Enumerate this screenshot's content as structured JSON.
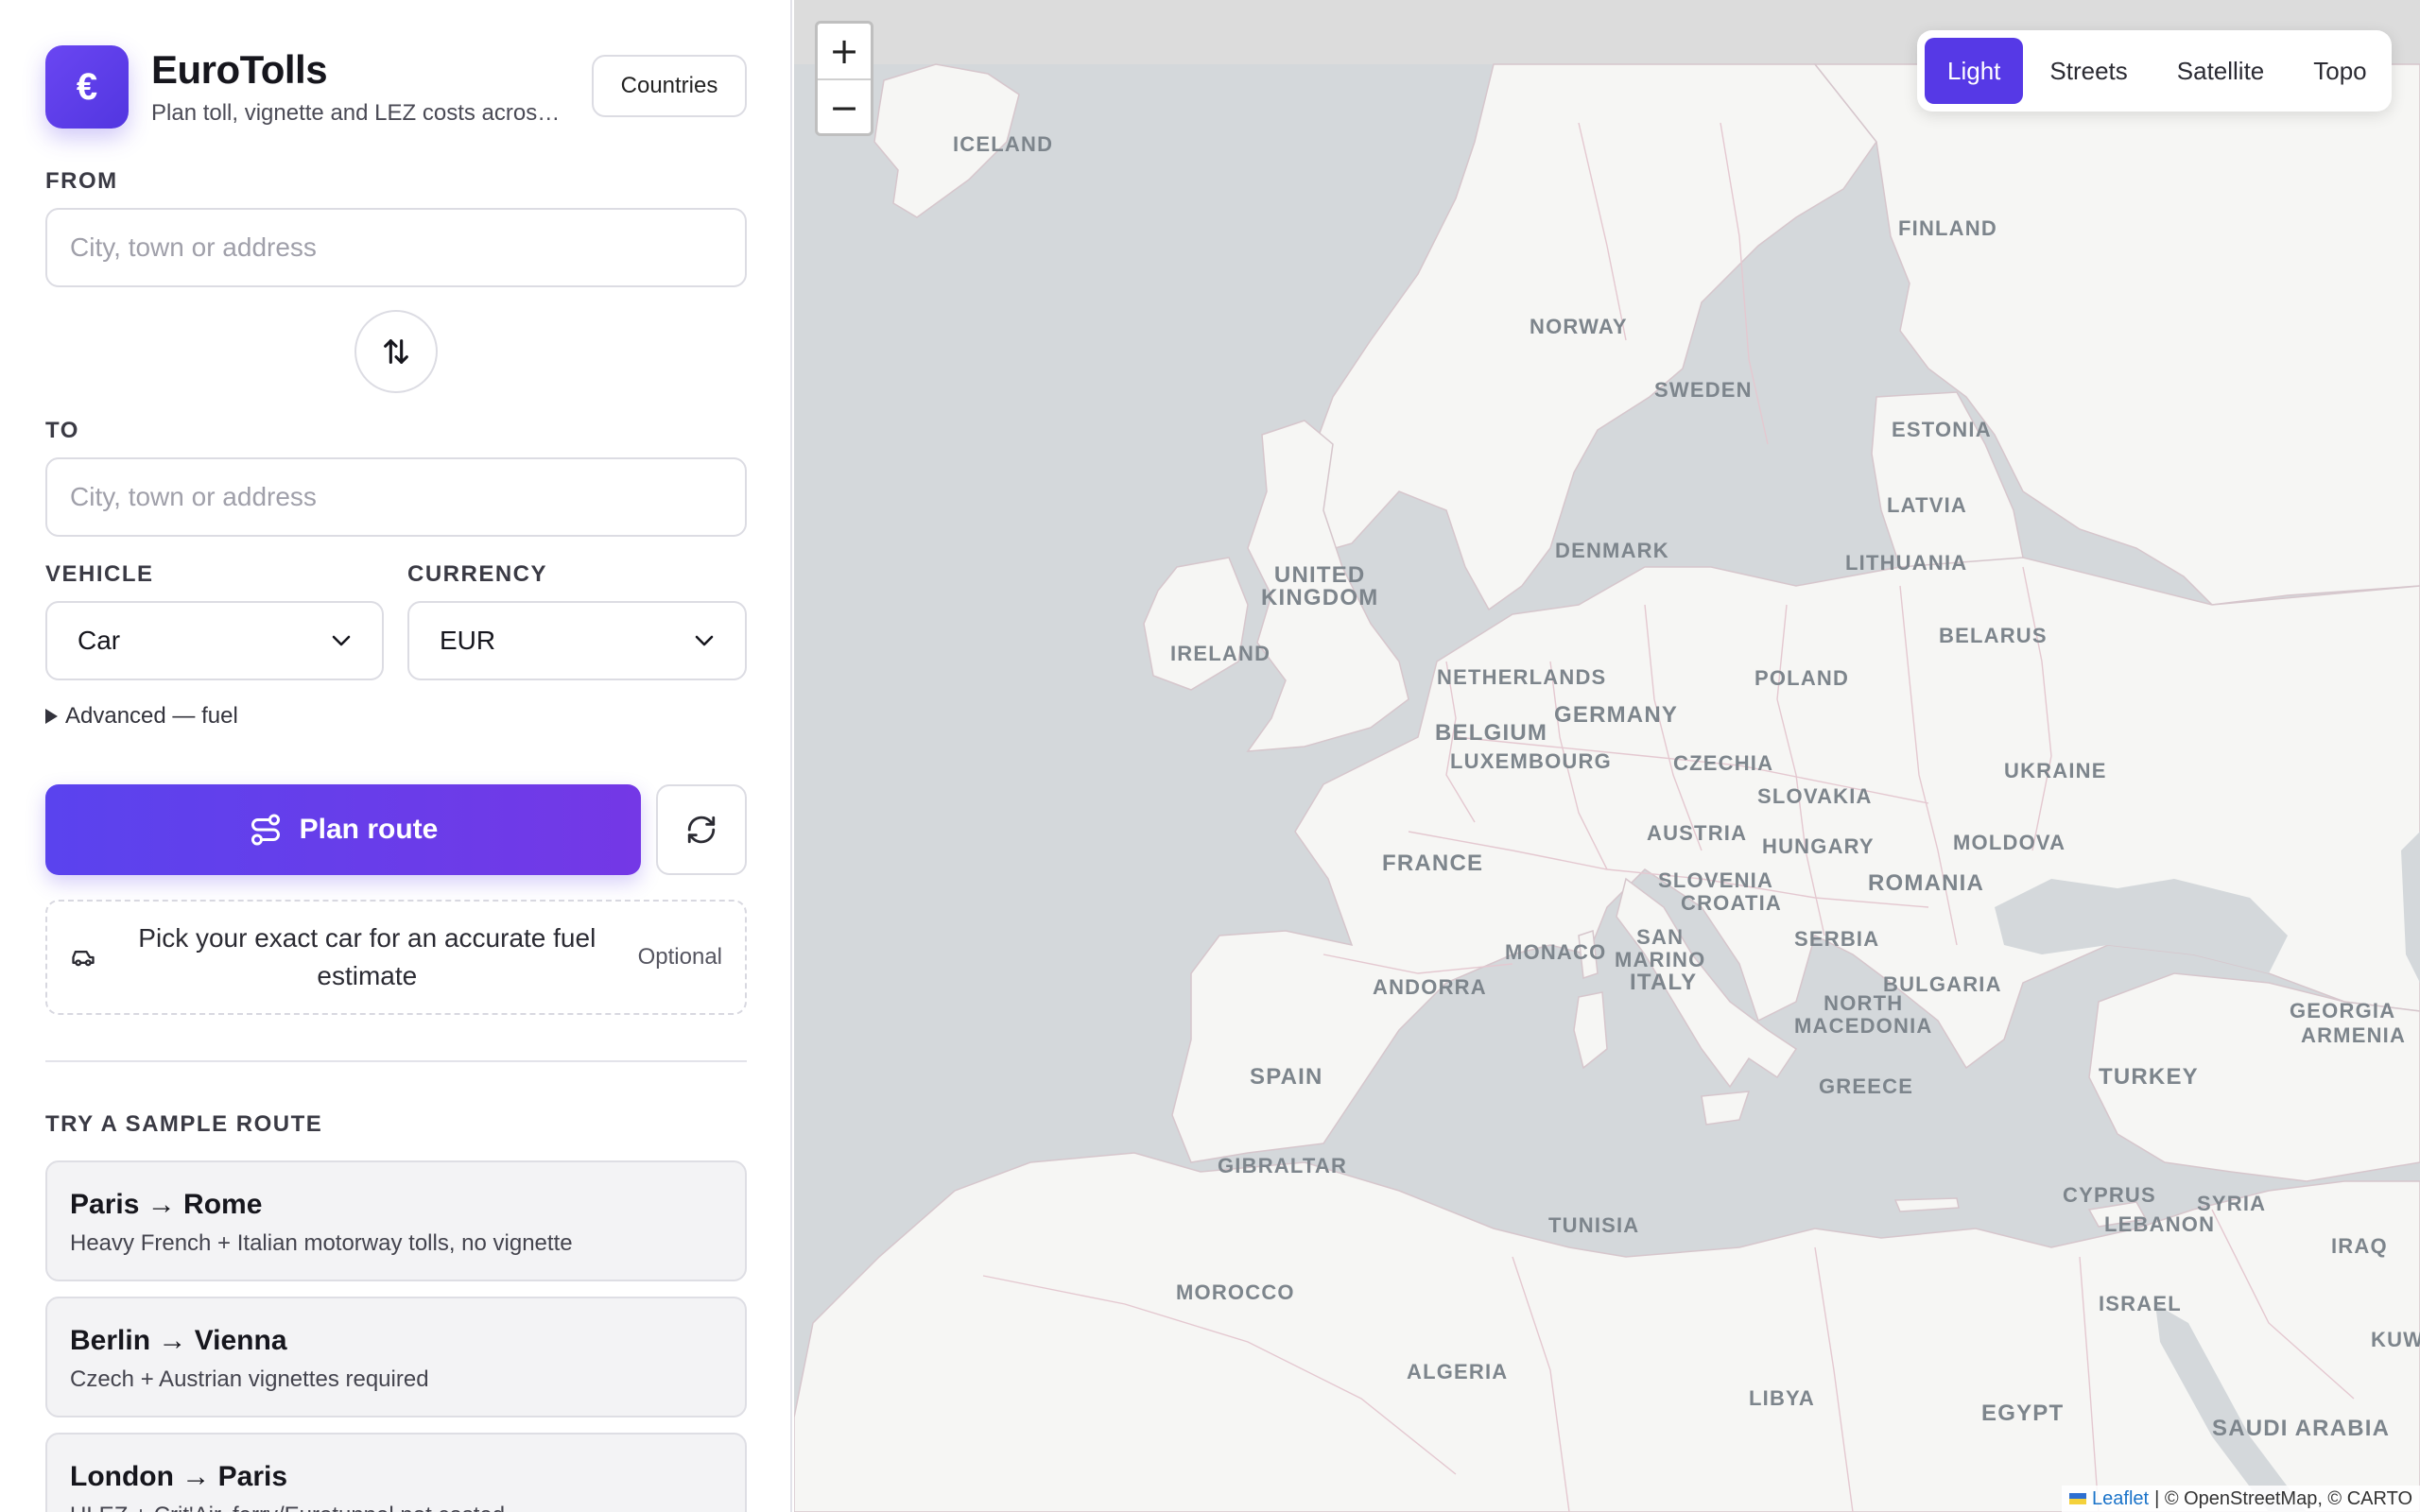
{
  "header": {
    "logo_glyph": "€",
    "title": "EuroTolls",
    "subtitle": "Plan toll, vignette and LEZ costs across Europe",
    "countries_label": "Countries"
  },
  "form": {
    "from_label": "FROM",
    "from_placeholder": "City, town or address",
    "to_label": "TO",
    "to_placeholder": "City, town or address",
    "vehicle_label": "VEHICLE",
    "vehicle_value": "Car",
    "currency_label": "CURRENCY",
    "currency_value": "EUR",
    "advanced_label": "Advanced — fuel",
    "plan_label": "Plan route",
    "car_pick_text": "Pick your exact car for an accurate fuel estimate",
    "car_pick_optional": "Optional"
  },
  "samples": {
    "title": "TRY A SAMPLE ROUTE",
    "routes": [
      {
        "name": "Paris → Rome",
        "desc": "Heavy French + Italian motorway tolls, no vignette"
      },
      {
        "name": "Berlin → Vienna",
        "desc": "Czech + Austrian vignettes required"
      },
      {
        "name": "London → Paris",
        "desc": "ULEZ + Crit'Air, ferry/Eurotunnel not costed"
      }
    ]
  },
  "map": {
    "zoom_in": "+",
    "zoom_out": "−",
    "layers": [
      "Light",
      "Streets",
      "Satellite",
      "Topo"
    ],
    "active_layer": "Light",
    "labels": {
      "iceland": "ICELAND",
      "finland": "FINLAND",
      "norway": "NORWAY",
      "sweden": "SWEDEN",
      "estonia": "ESTONIA",
      "latvia": "LATVIA",
      "denmark": "DENMARK",
      "lithuania": "LITHUANIA",
      "uk": "UNITED\nKINGDOM",
      "ireland": "IRELAND",
      "belarus": "BELARUS",
      "netherlands": "NETHERLANDS",
      "poland": "POLAND",
      "belgium": "BELGIUM",
      "germany": "GERMANY",
      "luxembourg": "LUXEMBOURG",
      "czechia": "CZECHIA",
      "ukraine": "UKRAINE",
      "slovakia": "SLOVAKIA",
      "austria": "AUSTRIA",
      "hungary": "HUNGARY",
      "moldova": "MOLDOVA",
      "france": "FRANCE",
      "slovenia": "SLOVENIA",
      "croatia": "CROATIA",
      "romania": "ROMANIA",
      "serbia": "SERBIA",
      "monaco": "MONACO",
      "san_marino": "SAN\nMARINO",
      "andorra": "ANDORRA",
      "italy": "ITALY",
      "bulgaria": "BULGARIA",
      "north_macedonia": "NORTH\nMACEDONIA",
      "georgia": "GEORGIA",
      "armenia": "ARMENIA",
      "spain": "SPAIN",
      "turkey": "TURKEY",
      "greece": "GREECE",
      "gibraltar": "GIBRALTAR",
      "cyprus": "CYPRUS",
      "syria": "SYRIA",
      "lebanon": "LEBANON",
      "tunisia": "TUNISIA",
      "iraq": "IRAQ",
      "morocco": "MOROCCO",
      "israel": "ISRAEL",
      "kuwait": "KUW",
      "algeria": "ALGERIA",
      "libya": "LIBYA",
      "egypt": "EGYPT",
      "saudi_arabia": "SAUDI ARABIA"
    },
    "attribution_leaflet": "Leaflet",
    "attribution_rest": "| © OpenStreetMap, © CARTO"
  }
}
